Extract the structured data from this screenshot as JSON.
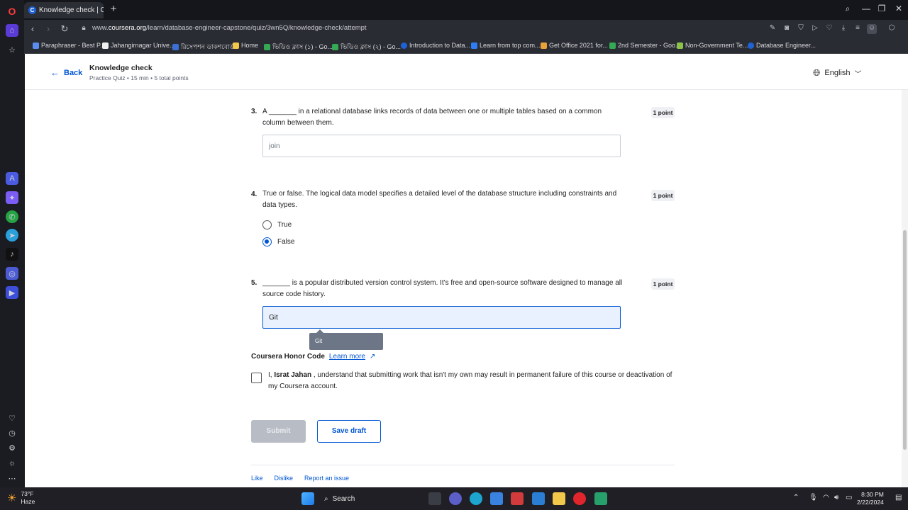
{
  "browser": {
    "tab_title": "Knowledge check | Course",
    "url_prefix": "www.",
    "url_domain": "coursera.org",
    "url_path": "/learn/database-engineer-capstone/quiz/3wn5Q/knowledge-check/attempt",
    "bookmarks": [
      {
        "label": "Paraphraser - Best P...",
        "color": "#5b8def"
      },
      {
        "label": "Jahangirnagar Unive...",
        "color": "#f0f0f0"
      },
      {
        "label": "রিসেপশন ডাকশবোর্ড",
        "color": "#3b6fd4"
      },
      {
        "label": "Home",
        "color": "#f2c84b"
      },
      {
        "label": "ভিডিও ক্লাস (১) - Go...",
        "color": "#34a853"
      },
      {
        "label": "ভিডিও ক্লাস (২) - Go...",
        "color": "#34a853"
      },
      {
        "label": "Introduction to Data...",
        "color": "#1f62d6"
      },
      {
        "label": "Learn from top com...",
        "color": "#2e7df6"
      },
      {
        "label": "Get Office 2021 for...",
        "color": "#e8a23a"
      },
      {
        "label": "2nd Semester - Goo...",
        "color": "#34a853"
      },
      {
        "label": "Non-Government Te...",
        "color": "#8bc34a"
      },
      {
        "label": "Database Engineer...",
        "color": "#1f62d6"
      }
    ]
  },
  "header": {
    "back_label": "Back",
    "title": "Knowledge check",
    "subtitle": "Practice Quiz • 15 min • 5 total points",
    "language": "English"
  },
  "questions": [
    {
      "num": "3.",
      "text": "A _______ in a relational database links records of data between one or multiple tables based on a common column between them.",
      "points": "1 point",
      "answer": "join"
    },
    {
      "num": "4.",
      "text": "True or false. The logical data model specifies a detailed level of the database structure including constraints and data types.",
      "points": "1 point",
      "options": [
        "True",
        "False"
      ],
      "selected": "False"
    },
    {
      "num": "5.",
      "text": "_______ is a popular distributed version control system. It's free and open-source software designed to manage all source code history.",
      "points": "1 point",
      "answer": "Git"
    }
  ],
  "suggestion": "Git",
  "honor": {
    "title": "Coursera Honor Code",
    "learn_more": "Learn more",
    "pledge_prefix": "I, ",
    "name": "Israt Jahan",
    "pledge_suffix": " , understand that submitting work that isn't my own may result in permanent failure of this course or deactivation of my Coursera account."
  },
  "actions": {
    "submit": "Submit",
    "save_draft": "Save draft"
  },
  "footer": {
    "like": "Like",
    "dislike": "Dislike",
    "report": "Report an issue"
  },
  "taskbar": {
    "temp": "73°F",
    "weather": "Haze",
    "search": "Search",
    "time": "8:30 PM",
    "date": "2/22/2024"
  }
}
